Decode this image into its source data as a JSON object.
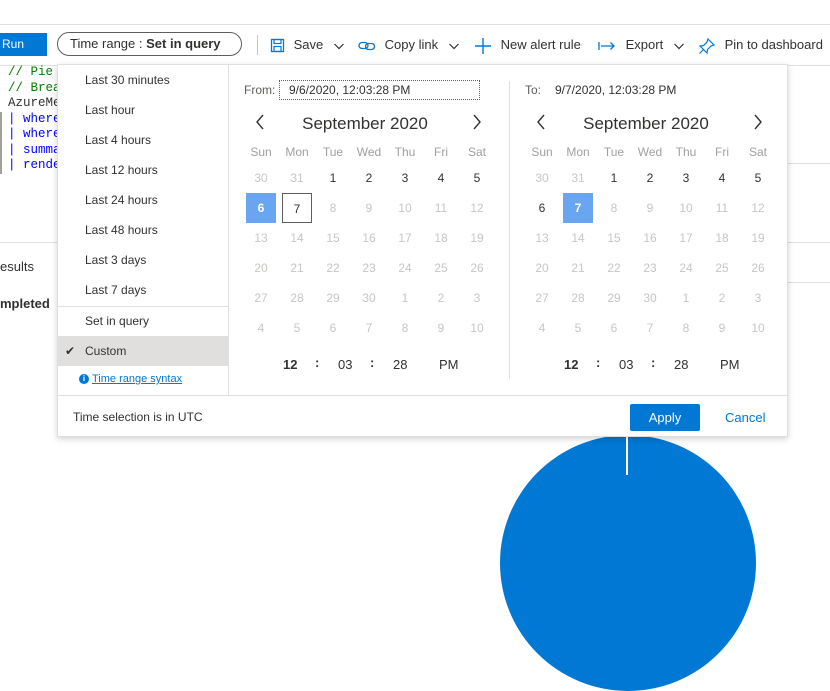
{
  "toolbar": {
    "run_label": "Run",
    "time_range_prefix": "Time range :",
    "time_range_value": "Set in query",
    "save_label": "Save",
    "copy_link_label": "Copy link",
    "new_alert_label": "New alert rule",
    "export_label": "Export",
    "pin_label": "Pin to dashboard"
  },
  "editor": {
    "lines": [
      "// Pie",
      "// Brea",
      "AzureMe",
      "| where",
      "| where",
      "| summa",
      "| rende"
    ]
  },
  "results": {
    "tab_label": "esults",
    "status_text": "mpleted"
  },
  "time_panel": {
    "options": [
      "Last 30 minutes",
      "Last hour",
      "Last 4 hours",
      "Last 12 hours",
      "Last 24 hours",
      "Last 48 hours",
      "Last 3 days",
      "Last 7 days",
      "Set in query",
      "Custom"
    ],
    "selected_option": "Custom",
    "syntax_link": "Time range syntax",
    "footer_note": "Time selection is in UTC",
    "apply_label": "Apply",
    "cancel_label": "Cancel",
    "from": {
      "label": "From:",
      "value": "9/6/2020, 12:03:28 PM",
      "month_title": "September 2020",
      "selected_day": "6",
      "today_day": "7",
      "hour": "12",
      "minute": "03",
      "second": "28",
      "ampm": "PM"
    },
    "to": {
      "label": "To:",
      "value": "9/7/2020, 12:03:28 PM",
      "month_title": "September 2020",
      "selected_day": "7",
      "hour": "12",
      "minute": "03",
      "second": "28",
      "ampm": "PM"
    },
    "weekdays": [
      "Sun",
      "Mon",
      "Tue",
      "Wed",
      "Thu",
      "Fri",
      "Sat"
    ],
    "weeks": [
      [
        "30",
        "31",
        "1",
        "2",
        "3",
        "4",
        "5"
      ],
      [
        "6",
        "7",
        "8",
        "9",
        "10",
        "11",
        "12"
      ],
      [
        "13",
        "14",
        "15",
        "16",
        "17",
        "18",
        "19"
      ],
      [
        "20",
        "21",
        "22",
        "23",
        "24",
        "25",
        "26"
      ],
      [
        "27",
        "28",
        "29",
        "30",
        "1",
        "2",
        "3"
      ],
      [
        "4",
        "5",
        "6",
        "7",
        "8",
        "9",
        "10"
      ]
    ],
    "time_separator": ":"
  },
  "colors": {
    "accent": "#0078d4",
    "selected_day": "#69a5f0"
  }
}
